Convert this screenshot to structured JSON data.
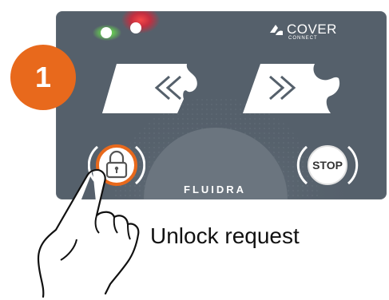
{
  "step": {
    "number": "1",
    "color": "#e8691c"
  },
  "brand": {
    "name": "COVER",
    "sub": "CONNECT",
    "icon": "cover-connect-logo-icon"
  },
  "manufacturer": "FLUIDRA",
  "indicators": {
    "green": "#6dff46",
    "red": "#ff1e2e"
  },
  "controls": {
    "open": {
      "icon": "double-chevron-left-icon"
    },
    "close": {
      "icon": "double-chevron-right-icon"
    },
    "unlock": {
      "icon": "padlock-icon",
      "ring_color": "#e8691c"
    },
    "stop": {
      "label": "STOP"
    }
  },
  "caption": "Unlock request",
  "pointer": {
    "icon": "hand-pointer-icon"
  },
  "colors": {
    "panel": "#55606b",
    "accent": "#e8691c"
  }
}
